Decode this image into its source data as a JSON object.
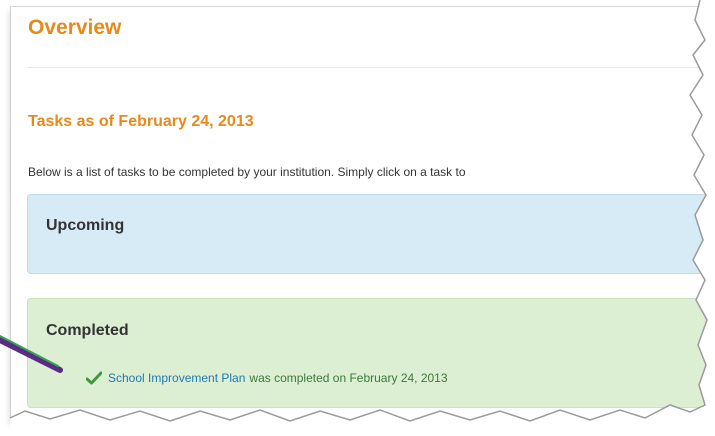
{
  "overview": {
    "title": "Overview",
    "tasks_heading": "Tasks as of February 24, 2013",
    "description": "Below is a list of tasks to be completed by your institution. Simply click on a task to"
  },
  "panels": {
    "upcoming": {
      "heading": "Upcoming"
    },
    "completed": {
      "heading": "Completed",
      "task_link": "School Improvement Plan",
      "task_status": "was completed on February 24, 2013"
    }
  },
  "icons": {
    "check": "check-icon"
  },
  "colors": {
    "heading_orange": "#e8891c",
    "upcoming_bg": "#d6ebf6",
    "completed_bg": "#dcefd3",
    "link_blue": "#1f78b4",
    "status_green": "#3a7a3a",
    "arrow_purple": "#5b2a86"
  }
}
